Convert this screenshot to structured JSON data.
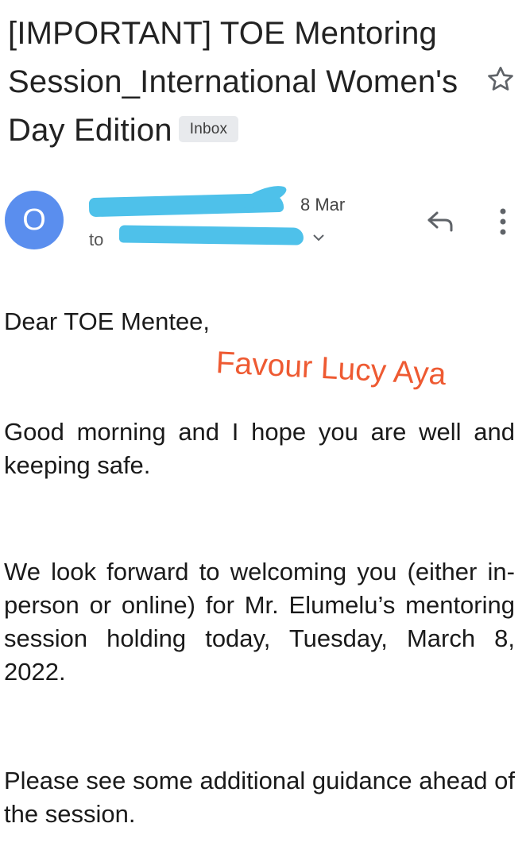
{
  "email": {
    "subject": "[IMPORTANT] TOE Mentoring Session_International Women's Day Edition",
    "label": "Inbox",
    "sender_initial": "O",
    "date": "8 Mar",
    "to_prefix": "to",
    "greeting": "Dear TOE Mentee,",
    "watermark": "Favour Lucy Aya",
    "paragraphs": [
      "Good morning and I hope you are well and keeping safe.",
      "We look forward to welcoming you (either in-person or online) for Mr. Elumelu’s mentoring session holding today, Tuesday, March 8, 2022.",
      "Please see some additional guidance ahead of the session."
    ]
  },
  "colors": {
    "avatar_bg": "#5a8eee",
    "redaction": "#4ec1ea",
    "watermark": "#ee5a32",
    "badge_bg": "#e8eaed"
  },
  "icons": {
    "star": "star-outline-icon",
    "reply": "reply-icon",
    "more": "more-vert-icon",
    "expand": "chevron-down-icon"
  }
}
